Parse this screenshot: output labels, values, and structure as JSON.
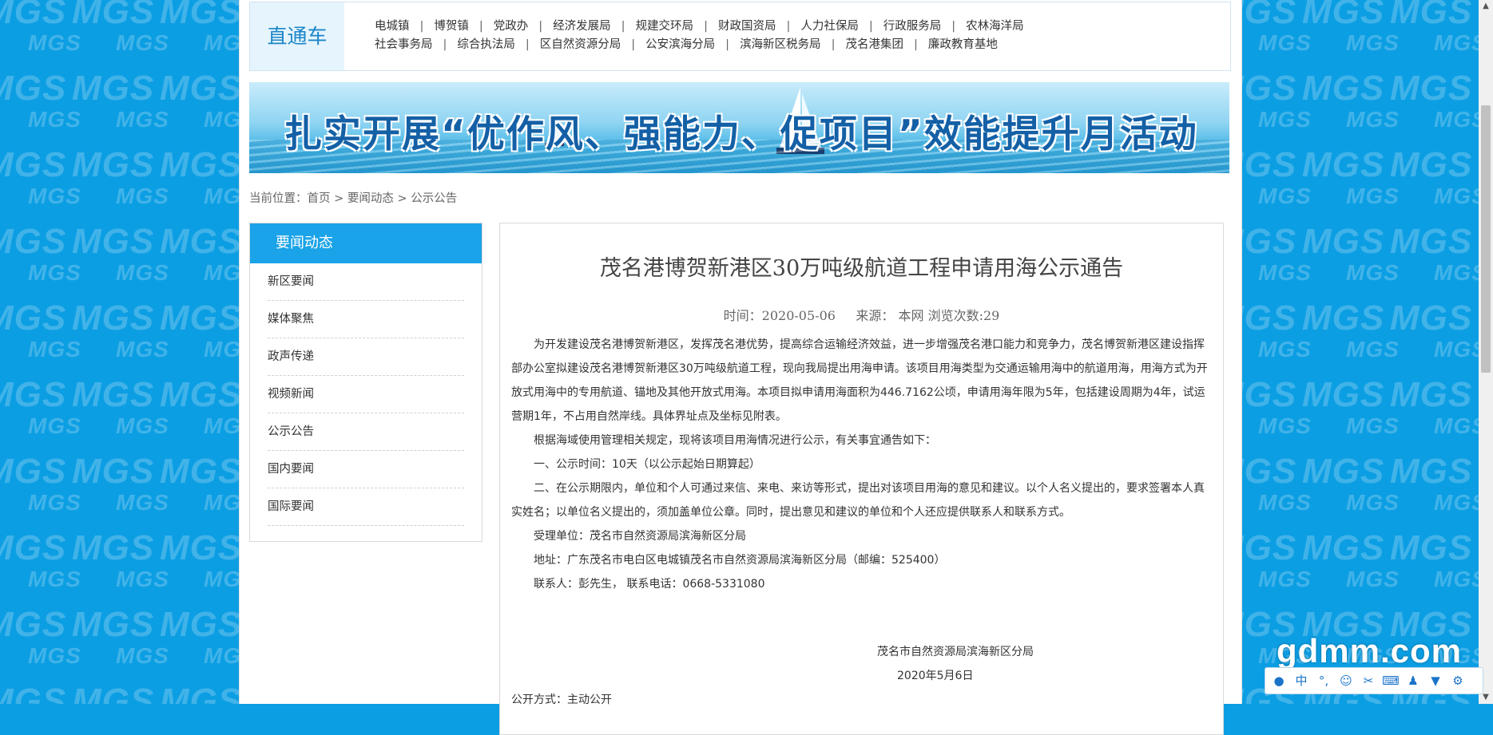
{
  "express": {
    "title": "直通车",
    "row1": [
      "电城镇",
      "博贺镇",
      "党政办",
      "经济发展局",
      "规建交环局",
      "财政国资局",
      "人力社保局",
      "行政服务局",
      "农林海洋局"
    ],
    "row2": [
      "社会事务局",
      "综合执法局",
      "区自然资源分局",
      "公安滨海分局",
      "滨海新区税务局",
      "茂名港集团",
      "廉政教育基地"
    ],
    "separator": "|"
  },
  "banner": {
    "text": "扎实开展“优作风、强能力、促项目”效能提升月活动"
  },
  "breadcrumb": {
    "label": "当前位置：",
    "home": "首页",
    "sep1": " > ",
    "section": "要闻动态",
    "sep2": " > ",
    "current": "公示公告"
  },
  "sidebar": {
    "heading": "要闻动态",
    "items": [
      {
        "label": "新区要闻"
      },
      {
        "label": "媒体聚焦"
      },
      {
        "label": "政声传递"
      },
      {
        "label": "视频新闻"
      },
      {
        "label": "公示公告"
      },
      {
        "label": "国内要闻"
      },
      {
        "label": "国际要闻"
      }
    ]
  },
  "article": {
    "title": "茂名港博贺新港区30万吨级航道工程申请用海公示通告",
    "meta": {
      "time_label": "时间：",
      "time": "2020-05-06",
      "source_label": "来源：",
      "source": "本网",
      "views_label": "浏览次数:",
      "views": "29"
    },
    "paragraphs": [
      "为开发建设茂名港博贺新港区，发挥茂名港优势，提高综合运输经济效益，进一步增强茂名港口能力和竞争力，茂名博贺新港区建设指挥部办公室拟建设茂名港博贺新港区30万吨级航道工程，现向我局提出用海申请。该项目用海类型为交通运输用海中的航道用海，用海方式为开放式用海中的专用航道、锚地及其他开放式用海。本项目拟申请用海面积为446.7162公顷，申请用海年限为5年，包括建设周期为4年，试运营期1年，不占用自然岸线。具体界址点及坐标见附表。",
      "根据海域使用管理相关规定，现将该项目用海情况进行公示，有关事宜通告如下：",
      "一、公示时间：10天（以公示起始日期算起）",
      "二、在公示期限内，单位和个人可通过来信、来电、来访等形式，提出对该项目用海的意见和建议。以个人名义提出的，要求签署本人真实姓名；以单位名义提出的，须加盖单位公章。同时，提出意见和建议的单位和个人还应提供联系人和联系方式。",
      "受理单位：茂名市自然资源局滨海新区分局",
      "地址：广东茂名市电白区电城镇茂名市自然资源局滨海新区分局（邮编：525400）",
      "联系人：彭先生，  联系电话：0668-5331080"
    ],
    "signature": "茂名市自然资源局滨海新区分局",
    "date": "2020年5月6日",
    "open_mode": "公开方式：主动公开"
  },
  "watermark": "gdmm.com",
  "ime": {
    "icons": [
      "user-icon",
      "chinese-mode-icon",
      "punctuation-icon",
      "emoji-icon",
      "scissors-icon",
      "keyboard-icon",
      "person-icon",
      "shirt-icon",
      "settings-icon"
    ],
    "mode_label": "中"
  },
  "background_word": "MGS",
  "colors": {
    "background": "#0c9ee3",
    "sidebar_header": "#1aa3e8",
    "express_title": "#1b86c8"
  }
}
